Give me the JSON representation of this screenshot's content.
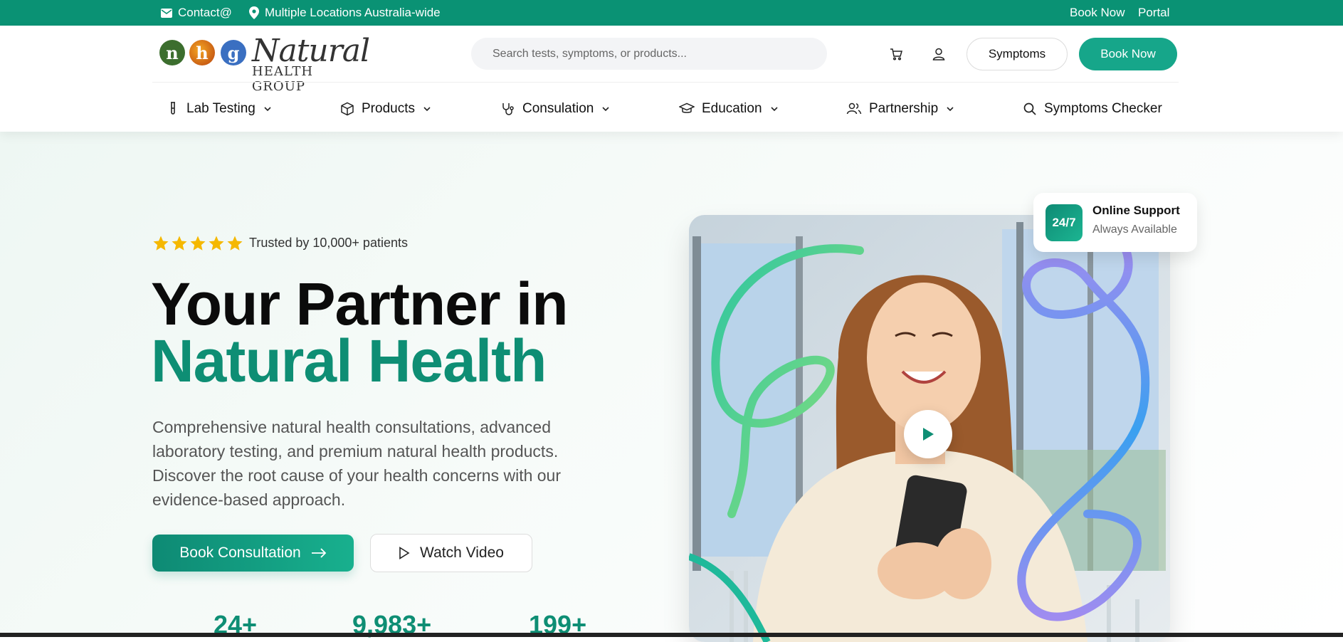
{
  "topbar": {
    "contact": "Contact@",
    "location": "Multiple Locations Australia-wide",
    "book_now": "Book Now",
    "portal": "Portal"
  },
  "header": {
    "logo_letters": [
      "n",
      "h",
      "g"
    ],
    "logo_word": "Natural",
    "logo_sub": "HEALTH GROUP",
    "search_placeholder": "Search tests, symptoms, or products...",
    "symptoms_button": "Symptoms",
    "book_now_button": "Book Now"
  },
  "nav": {
    "items": [
      {
        "label": "Lab Testing",
        "icon": "test-tube-icon"
      },
      {
        "label": "Products",
        "icon": "box-icon"
      },
      {
        "label": "Consulation",
        "icon": "stethoscope-icon"
      },
      {
        "label": "Education",
        "icon": "graduation-cap-icon"
      },
      {
        "label": "Partnership",
        "icon": "users-icon"
      },
      {
        "label": "Symptoms Checker",
        "icon": "search-icon"
      }
    ]
  },
  "hero": {
    "rating_stars": 5,
    "trusted": "Trusted by 10,000+ patients",
    "headline_line1": "Your Partner in",
    "headline_line2": "Natural Health",
    "description": "Comprehensive natural health consultations, advanced laboratory testing, and premium natural health products. Discover the root cause of your health concerns with our evidence-based approach.",
    "cta_primary": "Book Consultation",
    "cta_secondary": "Watch Video",
    "stats": [
      "24+",
      "9,983+",
      "199+"
    ]
  },
  "support_card": {
    "badge": "24/7",
    "title": "Online Support",
    "subtitle": "Always Available"
  },
  "colors": {
    "brand_green": "#0a9274",
    "accent_green": "#16a68a",
    "headline_green": "#0e8e74",
    "star_yellow": "#f5b800"
  }
}
